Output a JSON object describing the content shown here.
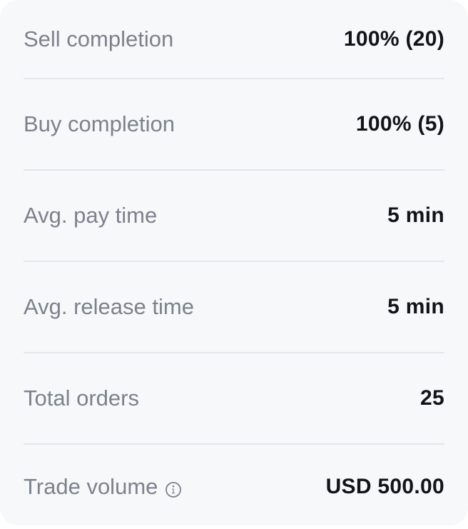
{
  "stats": {
    "rows": [
      {
        "label": "Sell completion",
        "value": "100% (20)"
      },
      {
        "label": "Buy completion",
        "value": "100% (5)"
      },
      {
        "label": "Avg. pay time",
        "value": "5 min"
      },
      {
        "label": "Avg. release time",
        "value": "5 min"
      },
      {
        "label": "Total orders",
        "value": "25"
      },
      {
        "label": "Trade volume",
        "value": "USD 500.00",
        "icon": "info-icon"
      }
    ]
  }
}
